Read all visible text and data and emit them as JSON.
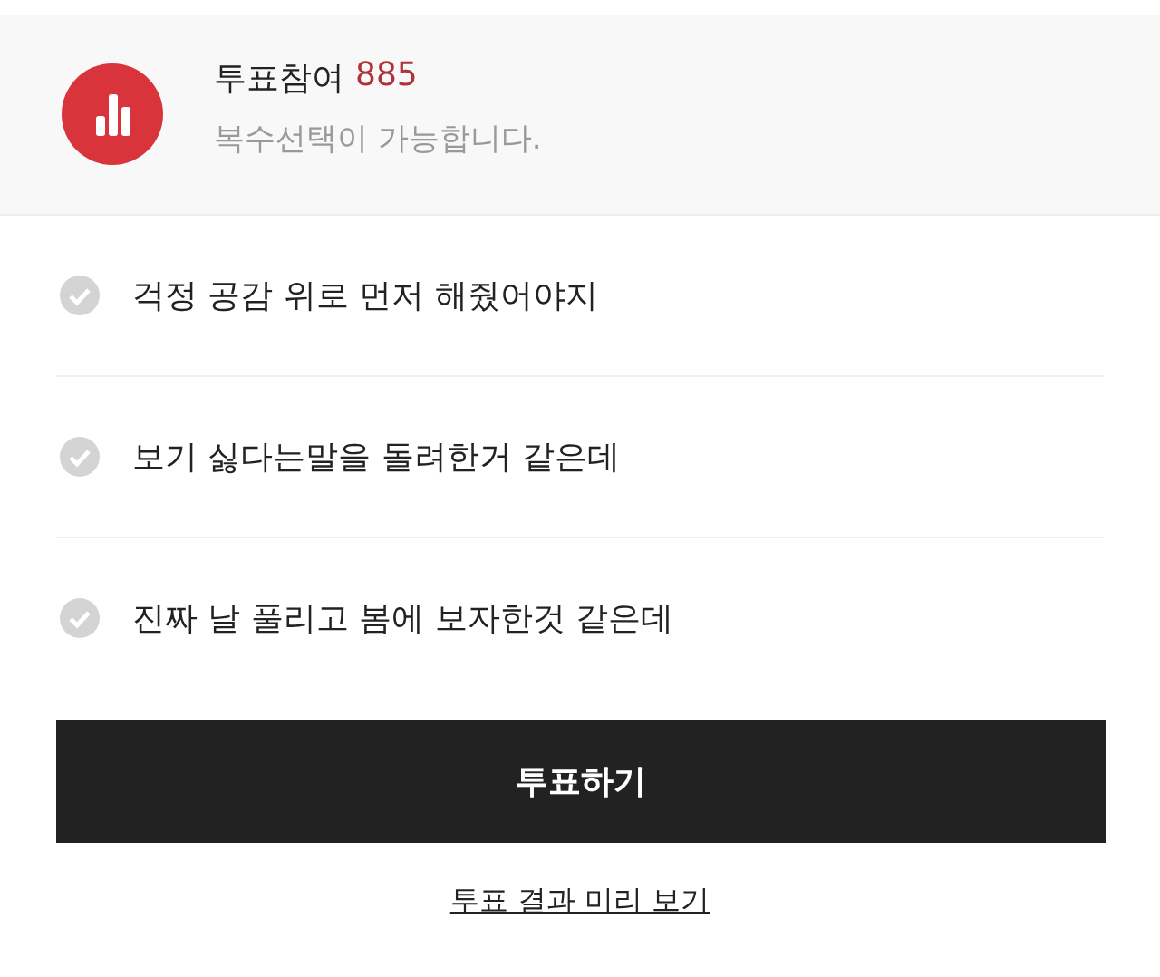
{
  "header": {
    "title": "투표참여",
    "count": "885",
    "subtitle": "복수선택이 가능합니다."
  },
  "options": [
    {
      "label": "걱정 공감 위로 먼저 해줬어야지",
      "selected": false
    },
    {
      "label": "보기 싫다는말을 돌려한거 같은데",
      "selected": false
    },
    {
      "label": "진짜 날 풀리고 봄에 보자한것 같은데",
      "selected": false
    }
  ],
  "vote_button": "투표하기",
  "preview_link": "투표 결과 미리 보기"
}
